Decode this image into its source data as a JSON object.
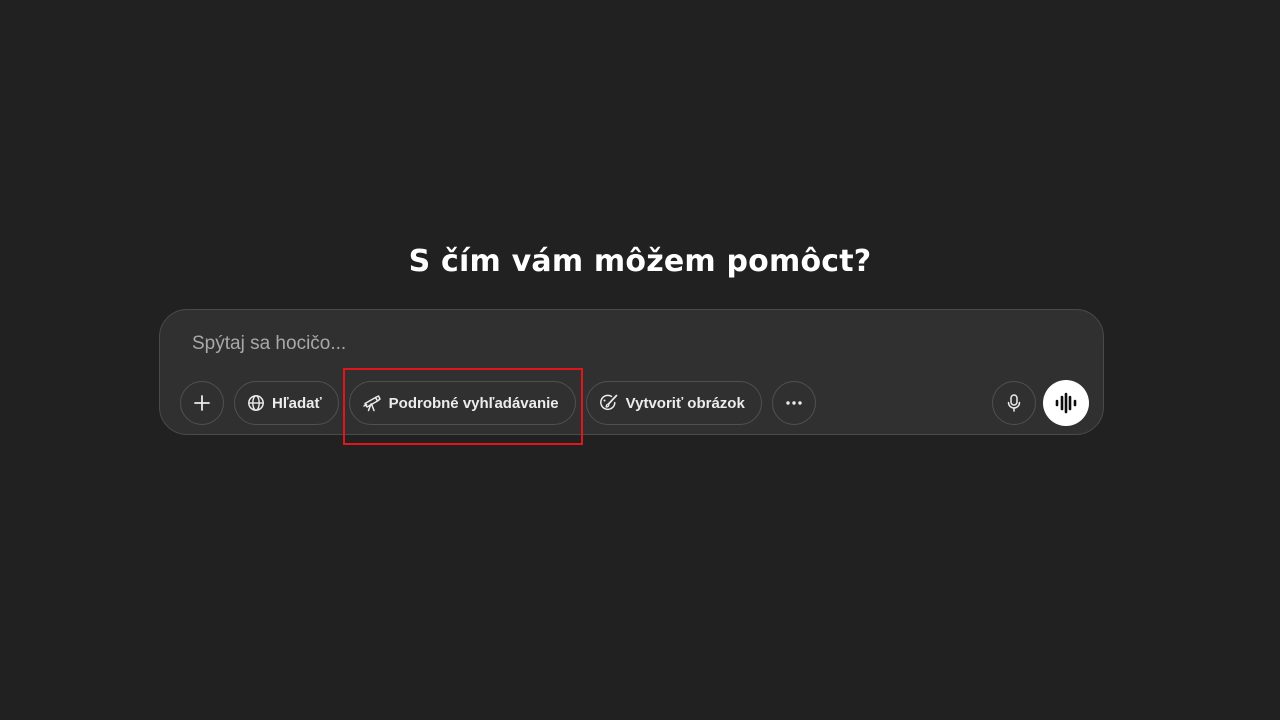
{
  "heading": "S čím vám môžem pomôct?",
  "composer": {
    "placeholder": "Spýtaj sa hocičo..."
  },
  "tools": {
    "add_icon": "plus-icon",
    "search": {
      "label": "Hľadať",
      "icon": "globe-icon"
    },
    "deep_research": {
      "label": "Podrobné vyhľadávanie",
      "icon": "telescope-icon"
    },
    "create_image": {
      "label": "Vytvoriť obrázok",
      "icon": "image-brush-icon"
    },
    "more_icon": "more-horizontal-icon",
    "mic_icon": "microphone-icon",
    "voice_icon": "voice-waveform-icon"
  },
  "colors": {
    "background": "#212121",
    "composer": "#303030",
    "highlight": "#e0161b",
    "voice_button": "#ffffff"
  }
}
